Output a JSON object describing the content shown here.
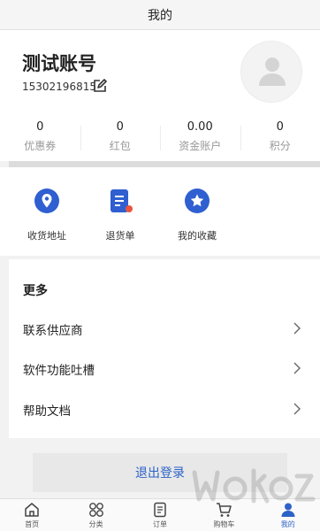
{
  "header": {
    "title": "我的"
  },
  "profile": {
    "name": "测试账号",
    "phone": "15302196815"
  },
  "stats": [
    {
      "value": "0",
      "label": "优惠券"
    },
    {
      "value": "0",
      "label": "红包"
    },
    {
      "value": "0.00",
      "label": "资金账户"
    },
    {
      "value": "0",
      "label": "积分"
    }
  ],
  "quick_actions": [
    {
      "label": "收货地址",
      "icon": "location-pin-icon"
    },
    {
      "label": "退货单",
      "icon": "return-order-icon"
    },
    {
      "label": "我的收藏",
      "icon": "star-favorite-icon"
    }
  ],
  "more": {
    "title": "更多",
    "items": [
      {
        "label": "联系供应商"
      },
      {
        "label": "软件功能吐槽"
      },
      {
        "label": "帮助文档"
      }
    ]
  },
  "logout_label": "退出登录",
  "tabbar": [
    {
      "label": "首页",
      "icon": "home-icon"
    },
    {
      "label": "分类",
      "icon": "category-icon"
    },
    {
      "label": "订单",
      "icon": "order-icon"
    },
    {
      "label": "购物车",
      "icon": "cart-icon"
    },
    {
      "label": "我的",
      "icon": "user-icon",
      "active": true
    }
  ],
  "colors": {
    "accent": "#2d62c8",
    "icon_blue": "#2f5fd0",
    "muted": "#999999"
  }
}
